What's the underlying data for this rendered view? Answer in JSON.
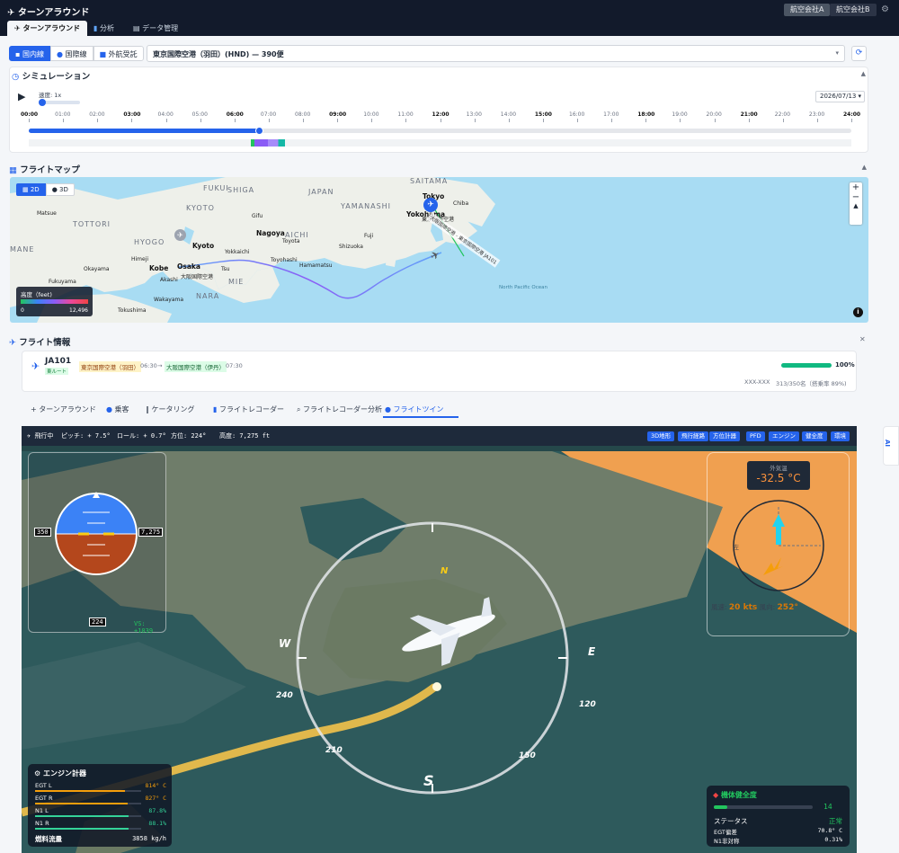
{
  "header": {
    "app_title": "ターンアラウンド",
    "tabs": [
      "ターンアラウンド",
      "分析",
      "データ管理"
    ],
    "companies": [
      "航空会社A",
      "航空会社B"
    ],
    "gear": "⚙"
  },
  "filter": {
    "segments": [
      "国内線",
      "国際線",
      "外航受託"
    ],
    "flight_select": "東京国際空港（羽田）(HND) — 390便"
  },
  "simulation": {
    "title": "シミュレーション",
    "speed_label": "速度: 1x",
    "date": "2026/07/13",
    "progress": 0.28,
    "ticks": [
      "00:00",
      "01:00",
      "02:00",
      "03:00",
      "04:00",
      "05:00",
      "06:00",
      "07:00",
      "08:00",
      "09:00",
      "10:00",
      "11:00",
      "12:00",
      "13:00",
      "14:00",
      "15:00",
      "16:00",
      "17:00",
      "18:00",
      "19:00",
      "20:00",
      "21:00",
      "22:00",
      "23:00",
      "24:00"
    ]
  },
  "flight_map": {
    "title": "フライトマップ",
    "mode_2d": "2D",
    "mode_3d": "3D",
    "zoom_in": "+",
    "zoom_out": "−",
    "compass": "▲",
    "info": "i",
    "labels": {
      "japan": "JAPAN",
      "saitama": "SAITAMA",
      "yamanashi": "YAMANASHI",
      "tottori": "TOTTORI",
      "hyogo": "HYOGO",
      "kyoto_pref": "KYOTO",
      "shiga": "SHIGA",
      "nara": "NARA",
      "mie": "MIE",
      "aichi": "AICHI",
      "fukui": "FUKUI",
      "maine": "MANE",
      "kyoto": "Kyoto",
      "osaka": "Osaka",
      "kobe": "Kobe",
      "nagoya": "Nagoya",
      "tokyo": "Tokyo",
      "yokohama": "Yokohama",
      "chiba": "Chiba",
      "shizuoka": "Shizuoka",
      "hamamatsu": "Hamamatsu",
      "toyota": "Toyota",
      "gifu": "Gifu",
      "matsue": "Matsue",
      "himeji": "Himeji",
      "okayama": "Okayama",
      "tokushima": "Tokushima",
      "wakayama": "Wakayama",
      "fukuyama": "Fukuyama",
      "akashi": "Akashi",
      "toyohashi": "Toyohashi",
      "yokkaichi": "Yokkaichi",
      "fuji": "Fuji",
      "tsu": "Tsu",
      "ocean": "North Pacific Ocean",
      "hnd_label": "東京国際空港",
      "itm_label": "大阪国際空港",
      "route_label": "大阪国際空港 - 東京国際空港 JA101"
    },
    "legend_title": "高度（feet)",
    "legend_min": "0",
    "legend_max": "12,496"
  },
  "flight_info": {
    "title": "フライト情報",
    "close": "✕",
    "registration": "JA101",
    "route_tag": "東ルート",
    "origin": "東京国際空港（羽田）",
    "dep_time": "06:30",
    "arrow": "→",
    "dest": "大阪国際空港（伊丹）",
    "arr_time": "07:30",
    "progress_pct": "100%",
    "progress": 1.0,
    "flight_no": "XXX-XXX",
    "pax": "313/350名（搭乗率 89%)"
  },
  "subtabs": [
    "+ ターンアラウンド",
    "乗客",
    "ケータリング",
    "フライトレコーダー",
    "フライトレコーダー分析",
    "フライトツイン"
  ],
  "twin": {
    "status": "飛行中",
    "pitch": "ピッチ: + 7.5°",
    "roll": "ロール: + 0.7°",
    "heading": "方位: 224°",
    "altitude": "高度: 7,275 ft",
    "buttons": [
      "3D地形",
      "飛行経路",
      "方位計器",
      "PFD",
      "エンジン",
      "健全度",
      "環境"
    ],
    "pfd": {
      "speed": "350",
      "alt": "7,275",
      "hdg": "224",
      "vs": "VS: +1039"
    },
    "env": {
      "oat_label": "外気温",
      "oat": "-32.5 °C",
      "left": "左",
      "wind_speed_label": "風速:",
      "wind_speed": "20 kts",
      "wind_dir_label": "風向:",
      "wind_dir": "252°"
    },
    "compass": {
      "N": "N",
      "E": "E",
      "S": "S",
      "W": "W",
      "t240": "240",
      "t210": "210",
      "t150": "150",
      "t120": "120"
    },
    "engine": {
      "title": "エンジン計器",
      "rows": [
        {
          "label": "EGT L",
          "value": "814° C",
          "level": 0.85
        },
        {
          "label": "EGT R",
          "value": "827° C",
          "level": 0.87
        },
        {
          "label": "N1 L",
          "value": "87.8%",
          "level": 0.878
        },
        {
          "label": "N1 R",
          "value": "88.1%",
          "level": 0.881
        }
      ],
      "fuel_label": "燃料流量",
      "fuel_value": "3858 kg/h"
    },
    "health": {
      "title": "機体健全度",
      "score": "14",
      "score_level": 0.14,
      "status_label": "ステータス",
      "status": "正常",
      "egt_dev_label": "EGT偏差",
      "egt_dev": "70.8° C",
      "n1_asym_label": "N1非対称",
      "n1_asym": "0.31%"
    }
  },
  "ai_tab": "AI",
  "colors": {
    "primary": "#2563eb",
    "navy": "#121a2b",
    "sea": "#a5dcf4",
    "land": "#eef0ea",
    "orange": "#f0a050",
    "route": "#f4c24a"
  }
}
